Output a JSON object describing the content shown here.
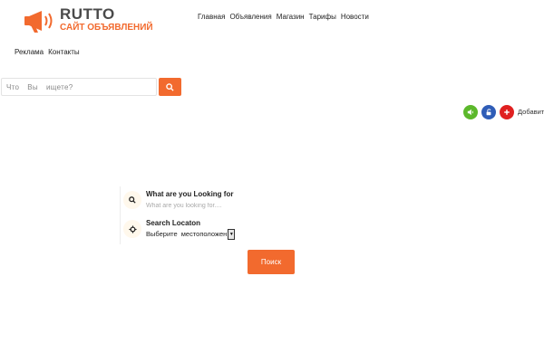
{
  "logo": {
    "title": "RUTTO",
    "subtitle": "САЙТ ОБЪЯВЛЕНИЙ"
  },
  "nav": {
    "top": [
      "Главная",
      "Объявления",
      "Магазин",
      "Тарифы",
      "Новости"
    ],
    "second": [
      "Реклама",
      "Контакты"
    ]
  },
  "header_search": {
    "placeholder": "Что  Вы  ищете?",
    "icon": "search-icon"
  },
  "actions": {
    "icons": [
      "sound-icon",
      "unlock-icon",
      "plus-icon"
    ],
    "add_label": "Добавить"
  },
  "main_search": {
    "what_label": "What are you Looking for",
    "what_placeholder": "What are you looking for....",
    "where_label": "Search Locaton",
    "where_value": "Выберите  местоположен",
    "button_label": "Поиск"
  },
  "colors": {
    "accent": "#f26a2e",
    "green": "#5cb82b",
    "blue": "#2f5db7",
    "red": "#e02020"
  }
}
